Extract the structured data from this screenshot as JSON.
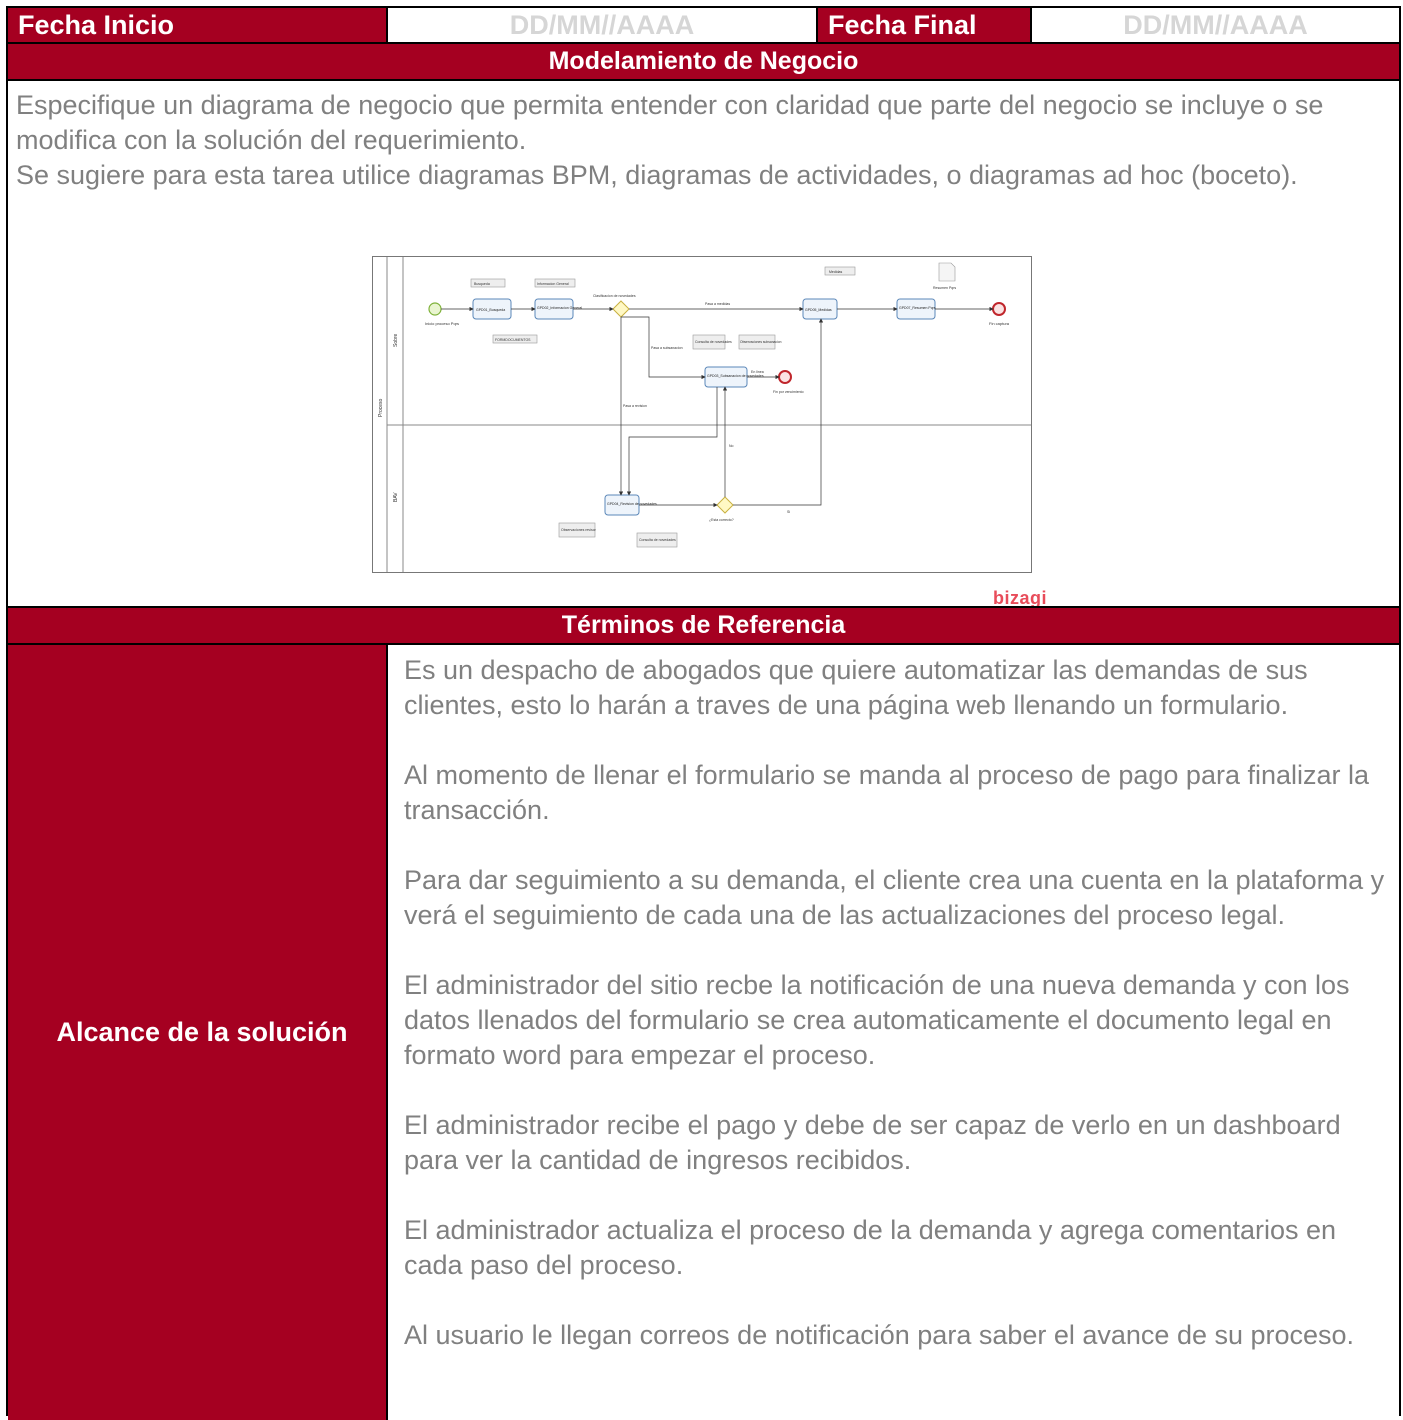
{
  "header": {
    "start_label": "Fecha Inicio",
    "start_value": "DD/MM//AAAA",
    "end_label": "Fecha Final",
    "end_value": "DD/MM//AAAA"
  },
  "business_model": {
    "title": "Modelamiento de Negocio",
    "paragraphs": [
      "Especifique un diagrama de negocio que permita entender con claridad que parte del negocio se incluye o se modifica con la solución del requerimiento.",
      "Se sugiere para esta tarea utilice diagramas BPM, diagramas de actividades, o diagramas ad hoc (boceto)."
    ],
    "watermark": "bizagi"
  },
  "diagram": {
    "pool": "Proceso",
    "lane_top": "Sobre",
    "lane_bottom": "BAV",
    "tasks": [
      "GPD01_Busqueda",
      "GPD02_Informacion General",
      "GPD03_Subsanacion de novedades",
      "GPD04_Revision de novedades",
      "GPD05_Medidas",
      "GPD07_Resumen Pqrs"
    ],
    "artifacts": [
      "Busqueda",
      "Informacion General",
      "FORMDOCUMENTOS",
      "Consulta de novedades",
      "Observaciones subsanacion",
      "Medidas",
      "Resumen Pqrs",
      "Observaciones revisor",
      "Consulta de novedades"
    ],
    "events": [
      "Inicio proceso Pqrs",
      "Fin captura",
      "Fin por vencimiento"
    ],
    "gateways": [
      "Clasificacion de novedades",
      "¿Esta correcto?"
    ],
    "flow_labels": [
      "Pasa a medidas",
      "Pasa a subsanacion",
      "Pasa a revision",
      "En linea",
      "No",
      "Si"
    ]
  },
  "terms": {
    "title": "Términos de Referencia",
    "label": "Alcance de la solución",
    "paragraphs": [
      "Es un despacho de abogados que quiere automatizar las demandas de sus clientes, esto lo harán a traves de una página web llenando un formulario.",
      "Al momento de llenar el formulario se manda al proceso de pago para finalizar la transacción.",
      "Para dar seguimiento a su demanda, el cliente crea una cuenta en la plataforma y verá el seguimiento de cada una de las actualizaciones del proceso legal.",
      "El administrador del sitio recbe la notificación de una nueva demanda y con los datos llenados del formulario se crea automaticamente el documento legal en formato word para empezar el proceso.",
      "El administrador recibe el pago y debe de ser capaz de verlo en un dashboard para ver la cantidad de ingresos recibidos.",
      "El administrador actualiza el proceso de la demanda y agrega comentarios en cada paso del proceso.",
      "Al usuario le llegan correos de notificación para saber el avance de su proceso."
    ]
  }
}
